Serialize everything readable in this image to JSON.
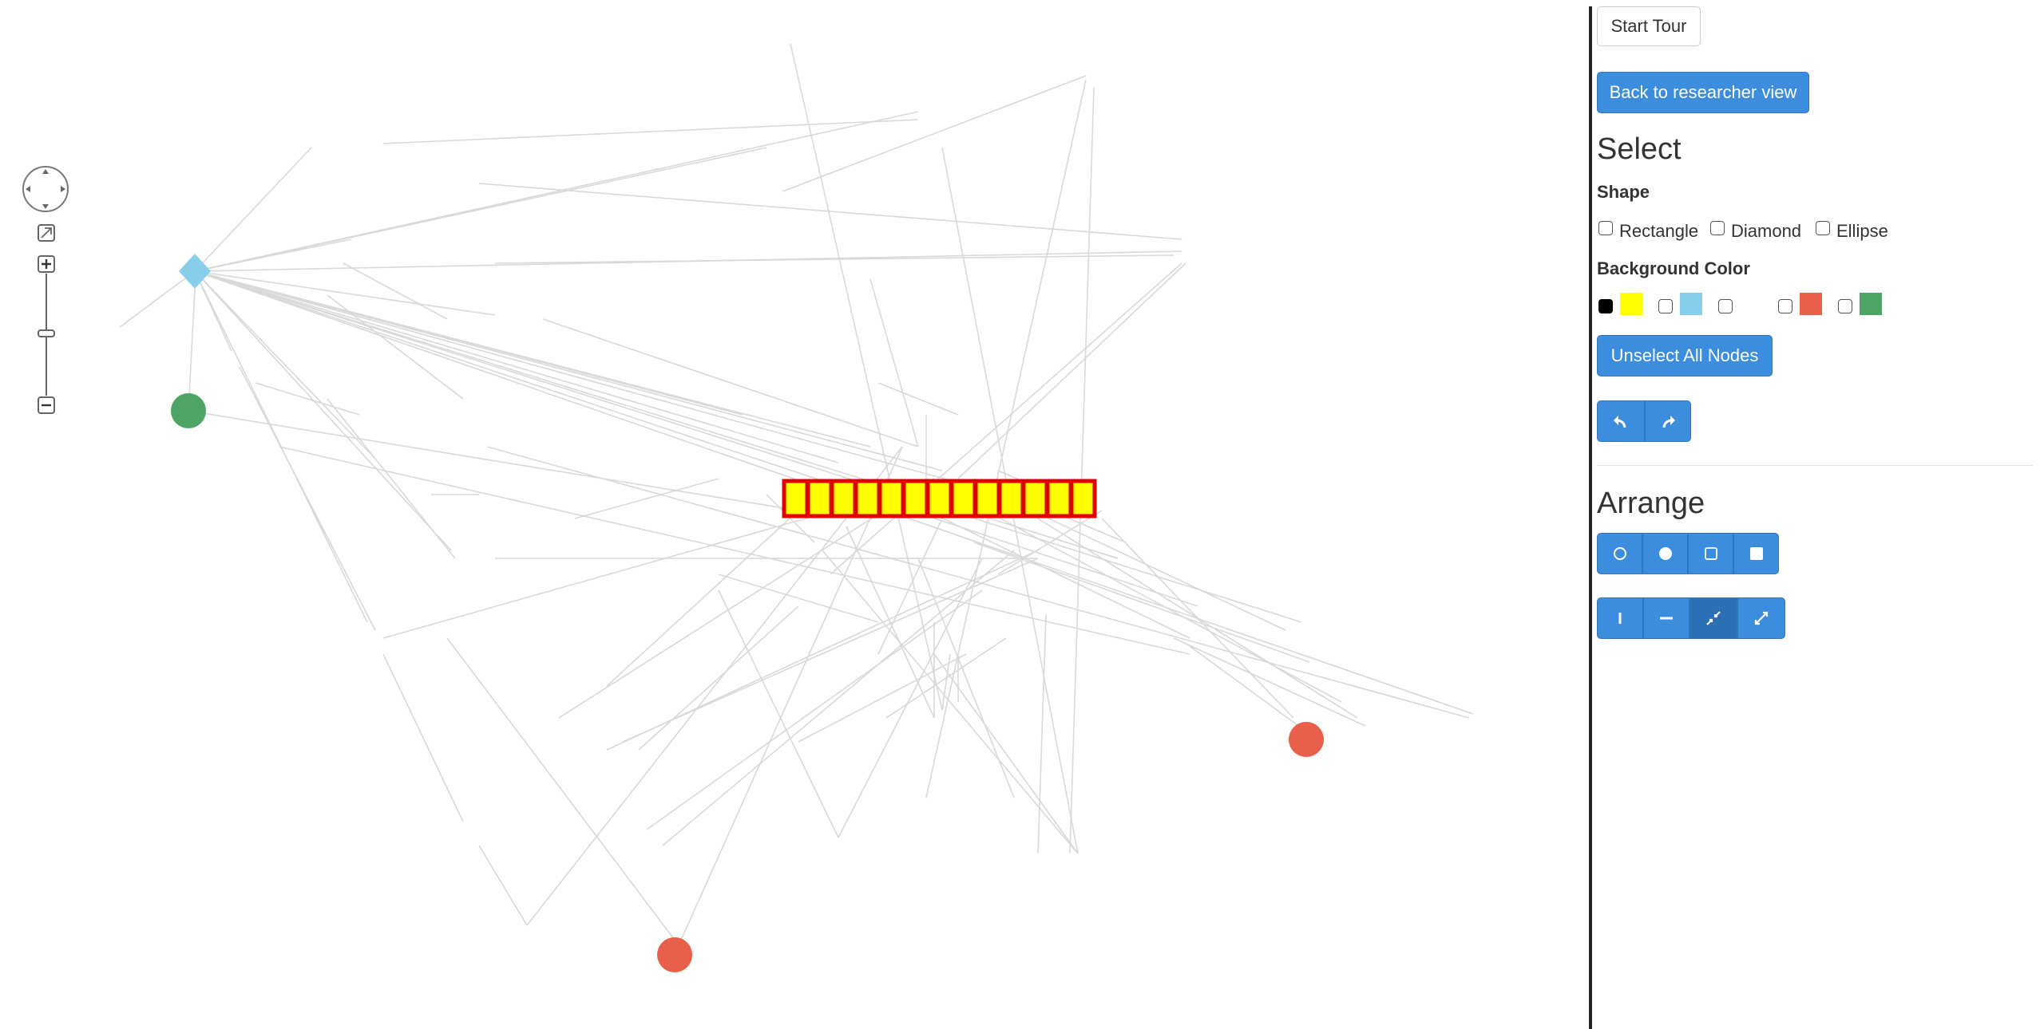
{
  "toolbar": {
    "start_tour": "Start Tour",
    "back_button": "Back to researcher view"
  },
  "select": {
    "title": "Select",
    "shape_label": "Shape",
    "shapes": [
      "Rectangle",
      "Diamond",
      "Ellipse"
    ],
    "bg_color_label": "Background Color",
    "colors": [
      {
        "name": "yellow",
        "hex": "#ffff00",
        "checked": true
      },
      {
        "name": "light-blue",
        "hex": "#87ceeb",
        "checked": false
      },
      {
        "name": "white",
        "hex": "#ffffff",
        "checked": false
      },
      {
        "name": "red",
        "hex": "#e8604c",
        "checked": false
      },
      {
        "name": "green",
        "hex": "#4ca565",
        "checked": false
      }
    ],
    "unselect_button": "Unselect All Nodes",
    "history_icons": [
      "undo-icon",
      "redo-icon"
    ]
  },
  "arrange": {
    "title": "Arrange",
    "layout_icons": [
      "circle-outline-icon",
      "circle-filled-icon",
      "square-outline-icon",
      "square-filled-icon"
    ],
    "align_icons": [
      "vertical-line-icon",
      "horizontal-line-icon",
      "compress-icon",
      "expand-icon"
    ],
    "active_align": "compress-icon"
  },
  "graph": {
    "edge_color": "#d9d9d9",
    "node_colors": {
      "diamond": "#87ceeb",
      "green": "#4ca565",
      "red": "#e8604c",
      "selected_fill": "#ffff00",
      "selected_border": "#e00000"
    },
    "selected_node_count": 13
  },
  "navigator": {
    "icons": [
      "pan-icon",
      "fit-icon",
      "zoom-in-icon",
      "zoom-slider-icon",
      "zoom-out-icon"
    ]
  }
}
